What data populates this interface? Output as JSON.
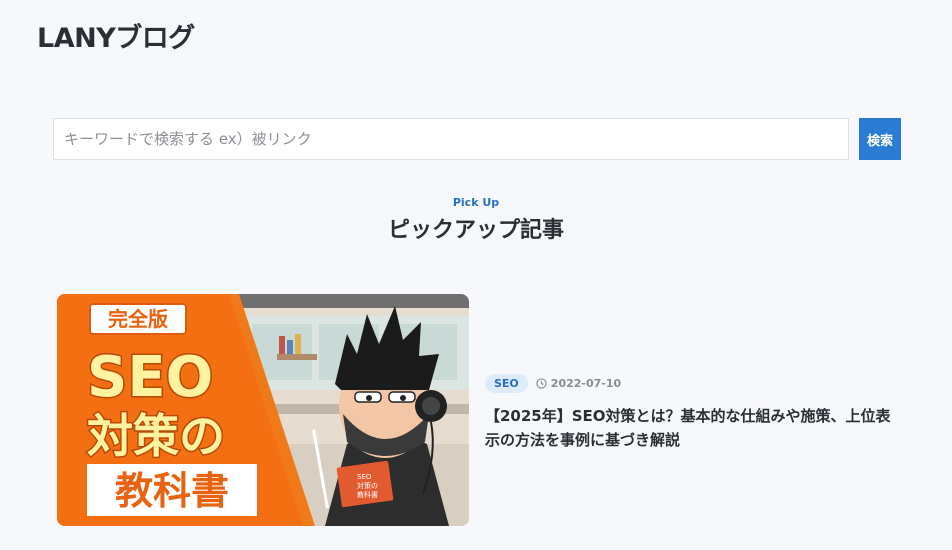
{
  "header": {
    "site_title": "LANYブログ"
  },
  "search": {
    "placeholder": "キーワードで検索する ex）被リンク",
    "value": "",
    "button_label": "検索"
  },
  "pickup": {
    "subtitle": "Pick Up",
    "title": "ピックアップ記事"
  },
  "article": {
    "category": "SEO",
    "date": "2022-07-10",
    "title": "【2025年】SEO対策とは？基本的な仕組みや施策、上位表示の方法を事例に基づき解説",
    "thumbnail": {
      "badge": "完全版",
      "main_text": "SEO",
      "line2": "対策の",
      "line3": "教科書",
      "book_title_1": "SEO",
      "book_title_2": "対策の",
      "book_title_3": "教科書"
    }
  },
  "colors": {
    "accent": "#2a7bd2",
    "thumbnail_orange": "#f07a1a",
    "thumbnail_yellow": "#fff3a0",
    "tag_bg": "#deebf8"
  },
  "icons": {
    "date": "clock-icon"
  }
}
